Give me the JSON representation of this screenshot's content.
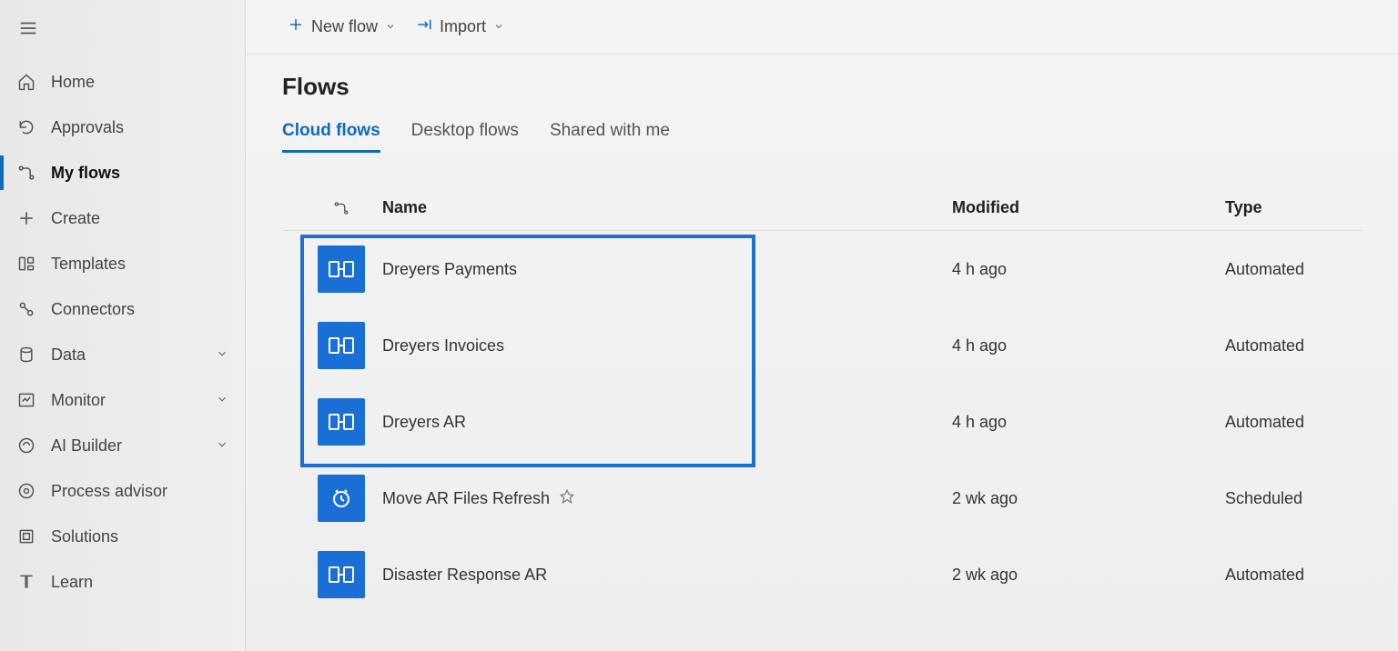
{
  "sidebar": {
    "items": [
      {
        "id": "home",
        "label": "Home",
        "icon": "home",
        "expandable": false
      },
      {
        "id": "approvals",
        "label": "Approvals",
        "icon": "approvals",
        "expandable": false
      },
      {
        "id": "my-flows",
        "label": "My flows",
        "icon": "flow",
        "expandable": false,
        "active": true
      },
      {
        "id": "create",
        "label": "Create",
        "icon": "plus",
        "expandable": false
      },
      {
        "id": "templates",
        "label": "Templates",
        "icon": "templates",
        "expandable": false
      },
      {
        "id": "connectors",
        "label": "Connectors",
        "icon": "connectors",
        "expandable": false
      },
      {
        "id": "data",
        "label": "Data",
        "icon": "data",
        "expandable": true
      },
      {
        "id": "monitor",
        "label": "Monitor",
        "icon": "monitor",
        "expandable": true
      },
      {
        "id": "ai-builder",
        "label": "AI Builder",
        "icon": "ai-builder",
        "expandable": true
      },
      {
        "id": "process-advisor",
        "label": "Process advisor",
        "icon": "process",
        "expandable": false
      },
      {
        "id": "solutions",
        "label": "Solutions",
        "icon": "solutions",
        "expandable": false
      },
      {
        "id": "learn",
        "label": "Learn",
        "icon": "learn",
        "expandable": false
      }
    ]
  },
  "toolbar": {
    "newflow_label": "New flow",
    "import_label": "Import"
  },
  "page": {
    "title": "Flows",
    "tabs": [
      {
        "label": "Cloud flows",
        "active": true
      },
      {
        "label": "Desktop flows",
        "active": false
      },
      {
        "label": "Shared with me",
        "active": false
      }
    ],
    "columns": {
      "name": "Name",
      "modified": "Modified",
      "type": "Type"
    },
    "rows": [
      {
        "name": "Dreyers Payments",
        "modified": "4 h ago",
        "type": "Automated",
        "icon": "flow",
        "starred": false
      },
      {
        "name": "Dreyers Invoices",
        "modified": "4 h ago",
        "type": "Automated",
        "icon": "flow",
        "starred": false
      },
      {
        "name": "Dreyers AR",
        "modified": "4 h ago",
        "type": "Automated",
        "icon": "flow",
        "starred": false
      },
      {
        "name": "Move AR Files Refresh",
        "modified": "2 wk ago",
        "type": "Scheduled",
        "icon": "clock",
        "starred": true
      },
      {
        "name": "Disaster Response AR",
        "modified": "2 wk ago",
        "type": "Automated",
        "icon": "flow",
        "starred": false
      }
    ],
    "highlight_rows": [
      0,
      1,
      2
    ]
  }
}
